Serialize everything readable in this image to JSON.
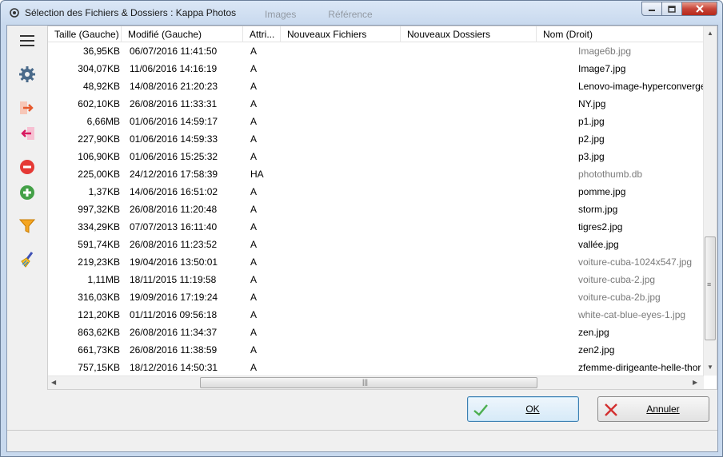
{
  "window": {
    "title": "Sélection des Fichiers & Dossiers : Kappa Photos",
    "background_tabs": [
      "Images",
      "Référence"
    ]
  },
  "sidebar": {
    "items": [
      {
        "icon": "hamburger-menu-icon"
      },
      {
        "icon": "gear-icon"
      },
      {
        "icon": "copy-right-icon"
      },
      {
        "icon": "copy-left-icon"
      },
      {
        "icon": "exclude-minus-icon"
      },
      {
        "icon": "include-plus-icon"
      },
      {
        "icon": "filter-icon"
      },
      {
        "icon": "clean-brush-icon"
      }
    ]
  },
  "grid": {
    "columns": [
      "Taille (Gauche)",
      "Modifié (Gauche)",
      "Attri...",
      "Nouveaux Fichiers",
      "Nouveaux Dossiers",
      "Nom (Droit)"
    ],
    "rows": [
      {
        "size": "36,95KB",
        "date": "06/07/2016 11:41:50",
        "attr": "A",
        "name": "Image6b.jpg",
        "grey": true
      },
      {
        "size": "304,07KB",
        "date": "11/06/2016 14:16:19",
        "attr": "A",
        "name": "Image7.jpg",
        "grey": false
      },
      {
        "size": "48,92KB",
        "date": "14/08/2016 21:20:23",
        "attr": "A",
        "name": "Lenovo-image-hyperconverge",
        "grey": false
      },
      {
        "size": "602,10KB",
        "date": "26/08/2016 11:33:31",
        "attr": "A",
        "name": "NY.jpg",
        "grey": false
      },
      {
        "size": "6,66MB",
        "date": "01/06/2016 14:59:17",
        "attr": "A",
        "name": "p1.jpg",
        "grey": false
      },
      {
        "size": "227,90KB",
        "date": "01/06/2016 14:59:33",
        "attr": "A",
        "name": "p2.jpg",
        "grey": false
      },
      {
        "size": "106,90KB",
        "date": "01/06/2016 15:25:32",
        "attr": "A",
        "name": "p3.jpg",
        "grey": false
      },
      {
        "size": "225,00KB",
        "date": "24/12/2016 17:58:39",
        "attr": "HA",
        "name": "photothumb.db",
        "grey": true
      },
      {
        "size": "1,37KB",
        "date": "14/06/2016 16:51:02",
        "attr": "A",
        "name": "pomme.jpg",
        "grey": false
      },
      {
        "size": "997,32KB",
        "date": "26/08/2016 11:20:48",
        "attr": "A",
        "name": "storm.jpg",
        "grey": false
      },
      {
        "size": "334,29KB",
        "date": "07/07/2013 16:11:40",
        "attr": "A",
        "name": "tigres2.jpg",
        "grey": false
      },
      {
        "size": "591,74KB",
        "date": "26/08/2016 11:23:52",
        "attr": "A",
        "name": "vallée.jpg",
        "grey": false
      },
      {
        "size": "219,23KB",
        "date": "19/04/2016 13:50:01",
        "attr": "A",
        "name": "voiture-cuba-1024x547.jpg",
        "grey": true
      },
      {
        "size": "1,11MB",
        "date": "18/11/2015 11:19:58",
        "attr": "A",
        "name": "voiture-cuba-2.jpg",
        "grey": true
      },
      {
        "size": "316,03KB",
        "date": "19/09/2016 17:19:24",
        "attr": "A",
        "name": "voiture-cuba-2b.jpg",
        "grey": true
      },
      {
        "size": "121,20KB",
        "date": "01/11/2016 09:56:18",
        "attr": "A",
        "name": "white-cat-blue-eyes-1.jpg",
        "grey": true
      },
      {
        "size": "863,62KB",
        "date": "26/08/2016 11:34:37",
        "attr": "A",
        "name": "zen.jpg",
        "grey": false
      },
      {
        "size": "661,73KB",
        "date": "26/08/2016 11:38:59",
        "attr": "A",
        "name": "zen2.jpg",
        "grey": false
      },
      {
        "size": "757,15KB",
        "date": "18/12/2016 14:50:31",
        "attr": "A",
        "name": "zfemme-dirigeante-helle-thor",
        "grey": false
      }
    ]
  },
  "buttons": {
    "ok": "OK",
    "cancel": "Annuler"
  },
  "colors": {
    "ok_check": "#4caf50",
    "cancel_x": "#d32f2f",
    "greyed_text": "#7a7a7a"
  }
}
